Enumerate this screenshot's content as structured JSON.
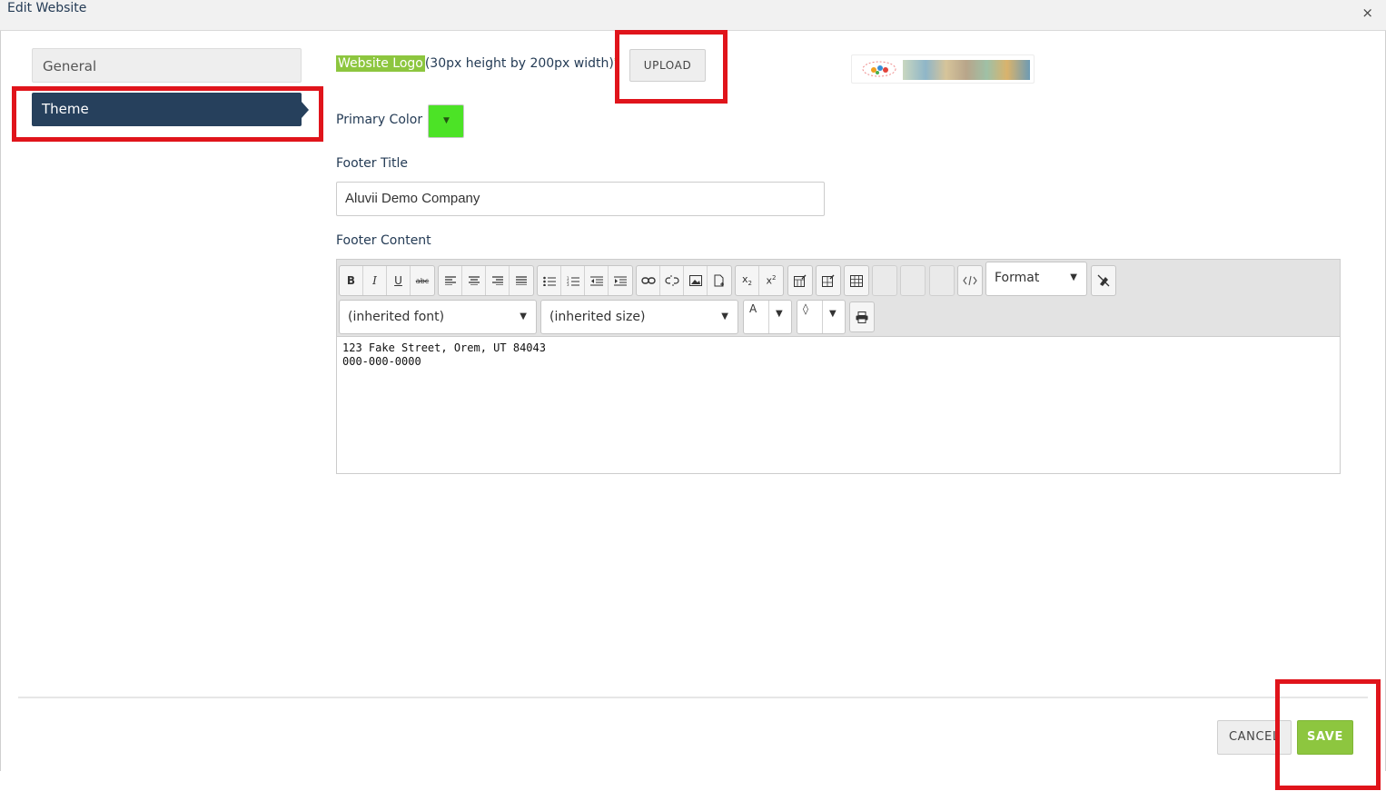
{
  "dialog": {
    "title": "Edit Website",
    "close_glyph": "×"
  },
  "tabs": [
    {
      "label": "General",
      "active": false
    },
    {
      "label": "Theme",
      "active": true
    }
  ],
  "logo": {
    "label": "Website Logo",
    "hint": "(30px height by 200px width)",
    "required_mark": "*",
    "upload_label": "UPLOAD"
  },
  "primary_color": {
    "label": "Primary Color",
    "value": "#4ce326",
    "caret": "▼"
  },
  "footer_title": {
    "label": "Footer Title",
    "value": "Aluvii Demo Company"
  },
  "footer_content": {
    "label": "Footer Content",
    "toolbar": {
      "format_label": "Format",
      "font_value": "(inherited font)",
      "size_value": "(inherited size)",
      "text_color_glyph": "A",
      "bg_color_glyph": "◊",
      "caret": "▼"
    },
    "lines": [
      "123 Fake Street, Orem, UT 84043",
      "000-000-0000"
    ]
  },
  "footer_buttons": {
    "cancel_label": "CANCEL",
    "save_label": "SAVE"
  },
  "colors": {
    "accent": "#8dc63f",
    "nav_active": "#26405c",
    "highlight": "#e0141b"
  }
}
